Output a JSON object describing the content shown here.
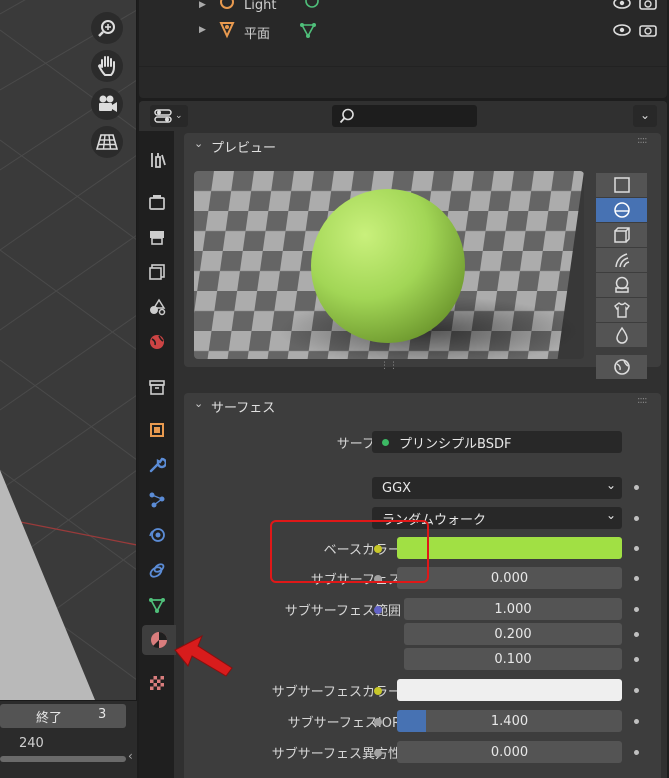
{
  "outliner": {
    "rows": [
      {
        "label": "Light"
      },
      {
        "label": "平面"
      }
    ]
  },
  "timeline": {
    "end_label": "終了",
    "end_value": "3",
    "frame": "240"
  },
  "preview_panel": {
    "title": "プレビュー"
  },
  "surface_panel": {
    "title": "サーフェス",
    "surface_label": "サーフェス",
    "surface_value": "プリンシプルBSDF",
    "distribution": "GGX",
    "subsurface_method": "ランダムウォーク",
    "base_color_label": "ベースカラー",
    "base_color": "#a1e044",
    "subsurface_label": "サブサーフェス",
    "subsurface_value": "0.000",
    "subsurface_radius_label": "サブサーフェス範囲",
    "radius": [
      "1.000",
      "0.200",
      "0.100"
    ],
    "subsurface_color_label": "サブサーフェスカラー",
    "subsurface_color": "#efefef",
    "ior_label": "サブサーフェスIOR",
    "ior_value": "1.400",
    "ior_fraction": 0.128,
    "anisotropy_label": "サブサーフェス異方性",
    "anisotropy_value": "0.000"
  },
  "colors": {
    "accent": "#4772b3",
    "annotation": "#e01818",
    "socket_yellow": "#c7c729",
    "socket_green": "#3cb964",
    "socket_purple": "#6363c7"
  }
}
